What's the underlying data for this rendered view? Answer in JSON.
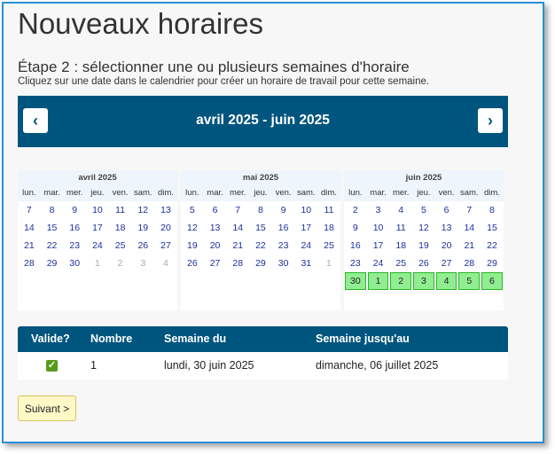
{
  "page": {
    "title": "Nouveaux horaires",
    "step": "Étape 2 : sélectionner une ou plusieurs semaines d'horaire",
    "hint": "Cliquez sur une date dans le calendrier pour créer un horaire de travail pour cette semaine."
  },
  "nav": {
    "prev_icon": "‹",
    "next_icon": "›",
    "range": "avril 2025 - juin 2025"
  },
  "weekdays": [
    "lun.",
    "mar.",
    "mer.",
    "jeu.",
    "ven.",
    "sam.",
    "dim."
  ],
  "months": [
    {
      "name": "avril 2025",
      "weeks": [
        [
          "7",
          "8",
          "9",
          "10",
          "11",
          "12",
          "13"
        ],
        [
          "14",
          "15",
          "16",
          "17",
          "18",
          "19",
          "20"
        ],
        [
          "21",
          "22",
          "23",
          "24",
          "25",
          "26",
          "27"
        ],
        [
          "28",
          "29",
          "30",
          "1",
          "2",
          "3",
          "4"
        ]
      ],
      "other_month": [
        [
          3,
          3
        ],
        [
          3,
          4
        ],
        [
          3,
          5
        ],
        [
          3,
          6
        ]
      ]
    },
    {
      "name": "mai 2025",
      "weeks": [
        [
          "5",
          "6",
          "7",
          "8",
          "9",
          "10",
          "11"
        ],
        [
          "12",
          "13",
          "14",
          "15",
          "16",
          "17",
          "18"
        ],
        [
          "19",
          "20",
          "21",
          "22",
          "23",
          "24",
          "25"
        ],
        [
          "26",
          "27",
          "28",
          "29",
          "30",
          "31",
          "1"
        ]
      ],
      "other_month": [
        [
          3,
          6
        ]
      ]
    },
    {
      "name": "juin 2025",
      "weeks": [
        [
          "2",
          "3",
          "4",
          "5",
          "6",
          "7",
          "8"
        ],
        [
          "9",
          "10",
          "11",
          "12",
          "13",
          "14",
          "15"
        ],
        [
          "16",
          "17",
          "18",
          "19",
          "20",
          "21",
          "22"
        ],
        [
          "23",
          "24",
          "25",
          "26",
          "27",
          "28",
          "29"
        ],
        [
          "30",
          "1",
          "2",
          "3",
          "4",
          "5",
          "6"
        ]
      ],
      "other_month": [],
      "selected_week": 4
    }
  ],
  "table": {
    "headers": {
      "valid": "Valide?",
      "number": "Nombre",
      "from": "Semaine du",
      "to": "Semaine jusqu'au"
    },
    "rows": [
      {
        "valid": true,
        "number": "1",
        "from": "lundi, 30 juin 2025",
        "to": "dimanche, 06 juillet 2025"
      }
    ]
  },
  "buttons": {
    "next": "Suivant >"
  },
  "colors": {
    "header": "#00557e",
    "selected_week": "#90ee90",
    "day_link": "#1a2fa0"
  }
}
